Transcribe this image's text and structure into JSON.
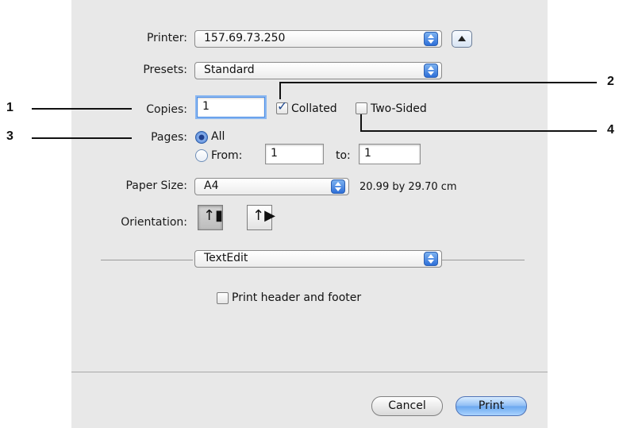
{
  "printer": {
    "label": "Printer:",
    "value": "157.69.73.250"
  },
  "presets": {
    "label": "Presets:",
    "value": "Standard"
  },
  "copies": {
    "label": "Copies:",
    "value": "1",
    "collated_label": "Collated",
    "collated_checked": true,
    "two_sided_label": "Two-Sided",
    "two_sided_checked": false
  },
  "pages": {
    "label": "Pages:",
    "all_label": "All",
    "from_label": "From:",
    "from_value": "1",
    "to_label": "to:",
    "to_value": "1",
    "selected": "All"
  },
  "paper_size": {
    "label": "Paper Size:",
    "value": "A4",
    "dimensions": "20.99 by 29.70 cm"
  },
  "orientation": {
    "label": "Orientation:",
    "options": [
      "portrait-icon",
      "landscape-icon"
    ],
    "selected": "portrait-icon"
  },
  "section_popup": {
    "value": "TextEdit"
  },
  "header_footer": {
    "label": "Print header and footer",
    "checked": false
  },
  "buttons": {
    "cancel": "Cancel",
    "print": "Print"
  },
  "callouts": [
    "1",
    "2",
    "3",
    "4"
  ]
}
